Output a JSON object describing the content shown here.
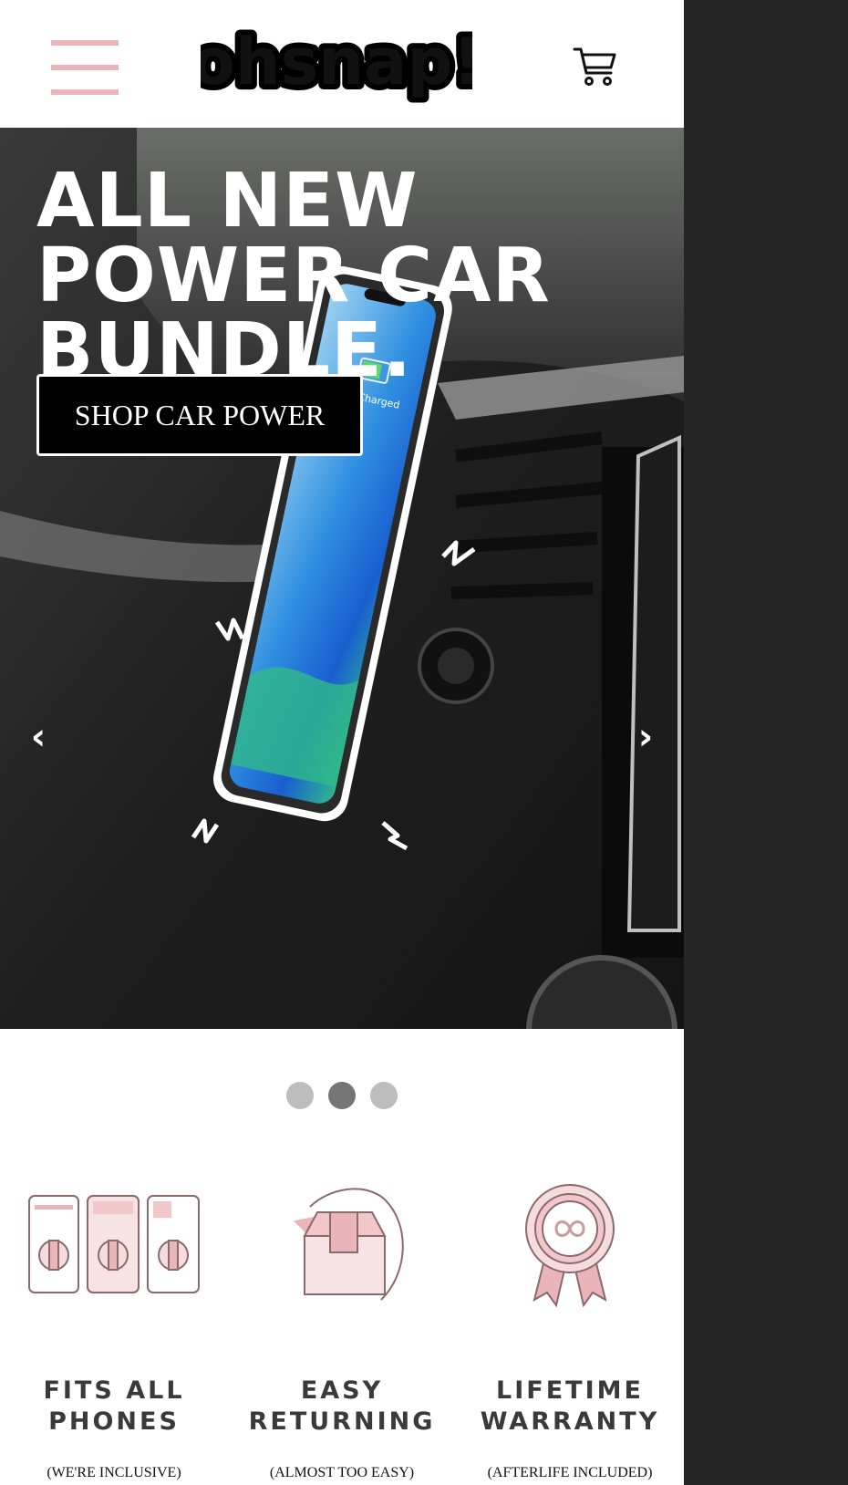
{
  "header": {
    "logo_text": "ohsnap!",
    "menu_icon": "hamburger-menu-icon",
    "cart_icon": "shopping-cart-icon"
  },
  "hero": {
    "headline_lines": [
      "ALL NEW",
      "POWER CAR",
      "BUNDLE."
    ],
    "cta_label": "SHOP CAR POWER",
    "phone_status": "64% Charged",
    "prev_arrow": "‹",
    "next_arrow": "›"
  },
  "carousel": {
    "slide_count": 3,
    "active_index": 1
  },
  "features": [
    {
      "title_lines": [
        "FITS ALL",
        "PHONES"
      ],
      "subtitle": "(WE'RE INCLUSIVE)",
      "icon": "phones-icon"
    },
    {
      "title_lines": [
        "EASY",
        "RETURNING"
      ],
      "subtitle": "(ALMOST TOO EASY)",
      "icon": "return-box-icon"
    },
    {
      "title_lines": [
        "LIFETIME",
        "WARRANTY"
      ],
      "subtitle": "(AFTERLIFE INCLUDED)",
      "icon": "warranty-ribbon-icon"
    }
  ],
  "colors": {
    "accent_pink": "#e9b5b8",
    "page_bg": "#ffffff",
    "side_bg": "#262626",
    "dot_active": "#757575",
    "dot_inactive": "#bdbdbd"
  }
}
